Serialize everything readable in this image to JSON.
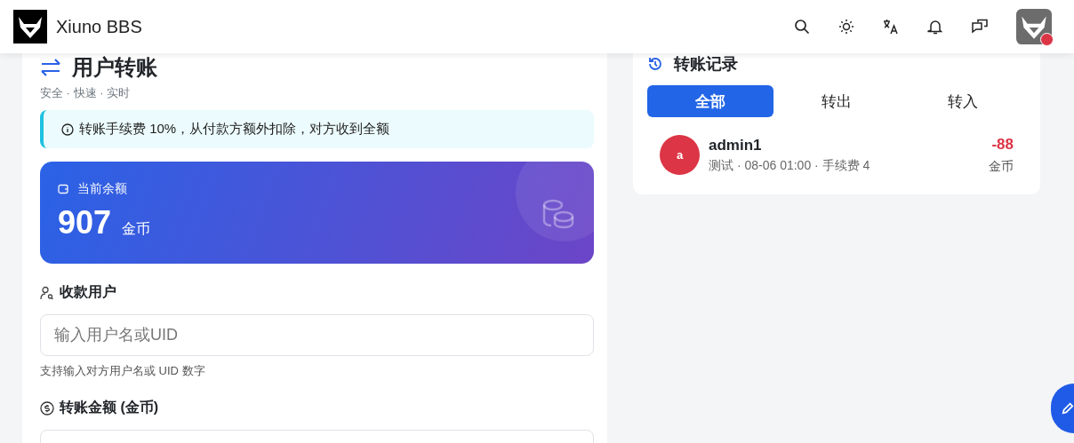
{
  "header": {
    "site_name": "Xiuno BBS"
  },
  "transfer": {
    "title": "用户转账",
    "subtitle": "安全 · 快速 · 实时",
    "notice": "转账手续费 10%，从付款方额外扣除，对方收到全额",
    "balance": {
      "label": "当前余额",
      "amount": "907",
      "unit": "金币"
    },
    "fields": [
      {
        "kind": "user",
        "label": "收款用户",
        "placeholder": "输入用户名或UID",
        "hint": "支持输入对方用户名或 UID 数字"
      },
      {
        "kind": "amount",
        "label": "转账金额 (金币)"
      }
    ]
  },
  "records": {
    "title": "转账记录",
    "tabs": [
      {
        "label": "全部",
        "selected": true
      },
      {
        "label": "转出",
        "selected": false
      },
      {
        "label": "转入",
        "selected": false
      }
    ],
    "items": [
      {
        "avatar": "a",
        "name": "admin1",
        "meta": "测试 · 08-06 01:00 · 手续费 4",
        "amount": "-88",
        "unit": "金币",
        "color": "#dc3545"
      }
    ]
  }
}
